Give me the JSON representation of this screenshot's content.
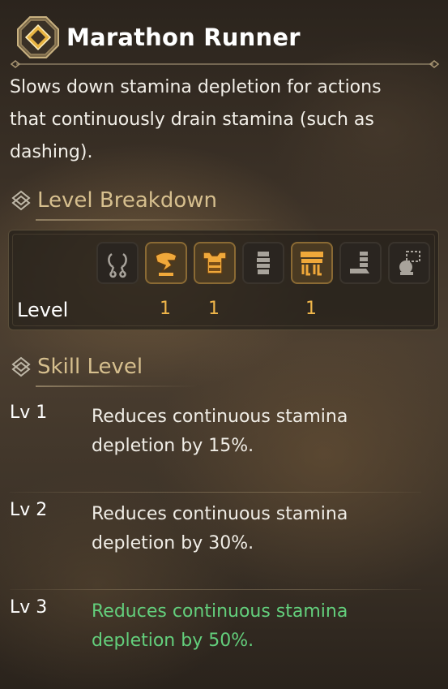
{
  "skill": {
    "title": "Marathon Runner",
    "description": "Slows down stamina depletion for actions that continuously drain stamina (such as dashing).",
    "icon": "skill-diamond-icon",
    "accent_color": "#d6bf8e"
  },
  "breakdown": {
    "header": "Level Breakdown",
    "row_label": "Level",
    "equipment": [
      {
        "icon": "charm-icon",
        "active": false,
        "level": ""
      },
      {
        "icon": "helm-icon",
        "active": true,
        "level": "1"
      },
      {
        "icon": "chest-armor-icon",
        "active": true,
        "level": "1"
      },
      {
        "icon": "arm-armor-icon",
        "active": false,
        "level": ""
      },
      {
        "icon": "waist-armor-icon",
        "active": true,
        "level": "1"
      },
      {
        "icon": "leg-armor-icon",
        "active": false,
        "level": ""
      },
      {
        "icon": "decoration-icon",
        "active": false,
        "level": ""
      }
    ],
    "level_color": "#f0b64a"
  },
  "skill_levels": {
    "header": "Skill Level",
    "current_color": "#63cf7c",
    "levels": [
      {
        "name": "Lv 1",
        "description": "Reduces continuous stamina depletion by 15%.",
        "current": false
      },
      {
        "name": "Lv 2",
        "description": "Reduces continuous stamina depletion by 30%.",
        "current": false
      },
      {
        "name": "Lv 3",
        "description": "Reduces continuous stamina depletion by 50%.",
        "current": true
      }
    ]
  }
}
